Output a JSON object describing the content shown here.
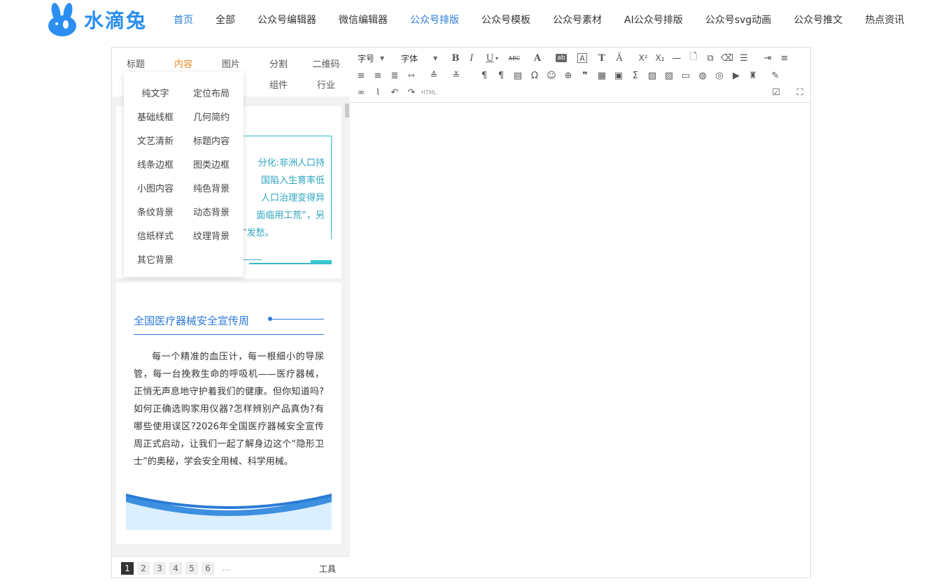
{
  "brand": {
    "name": "水滴兔"
  },
  "nav": {
    "items": [
      {
        "label": "首页"
      },
      {
        "label": "全部"
      },
      {
        "label": "公众号编辑器"
      },
      {
        "label": "微信编辑器"
      },
      {
        "label": "公众号排版"
      },
      {
        "label": "公众号模板"
      },
      {
        "label": "公众号素材"
      },
      {
        "label": "AI公众号排版"
      },
      {
        "label": "公众号svg动画"
      },
      {
        "label": "公众号推文"
      },
      {
        "label": "热点资讯"
      }
    ]
  },
  "categories": {
    "row1": [
      "标题",
      "内容",
      "图片",
      "分割",
      "二维码"
    ],
    "row2": [
      "组件",
      "行业"
    ],
    "active": "内容"
  },
  "dropdown": {
    "items": [
      "纯文字",
      "定位布局",
      "基础线框",
      "几何简约",
      "文艺清新",
      "标题内容",
      "线条边框",
      "图类边框",
      "小图内容",
      "纯色背景",
      "条纹背景",
      "动态背景",
      "信纸样式",
      "纹理背景",
      "其它背景"
    ]
  },
  "cards": {
    "card1": {
      "lines": [
        "分化:非洲人口持",
        "国陷入生育率低",
        "人口治理变得异",
        "面临用工荒”，另",
        "”发愁。"
      ]
    },
    "card2": {
      "title": "全国医疗器械安全宣传周",
      "body": "每一个精准的血压计，每一根细小的导尿管，每一台挽救生命的呼吸机——医疗器械，正悄无声息地守护着我们的健康。但你知道吗?如何正确选购家用仪器?怎样辨别产品真伪?有哪些使用误区?2026年全国医疗器械安全宣传周正式启动，让我们一起了解身边这个“隐形卫士”的奥秘，学会安全用械、科学用械。"
    }
  },
  "pager": {
    "pages": [
      "1",
      "2",
      "3",
      "4",
      "5",
      "6"
    ],
    "current": "1",
    "ellipsis": "…",
    "tools_label": "工具"
  },
  "toolbar": {
    "fontsize_label": "字号",
    "fontfamily_label": "字体",
    "html_label": "HTML"
  },
  "colors": {
    "accent": "#2b7bd6",
    "active_tab": "#f08a24",
    "teal": "#39b3c7"
  }
}
